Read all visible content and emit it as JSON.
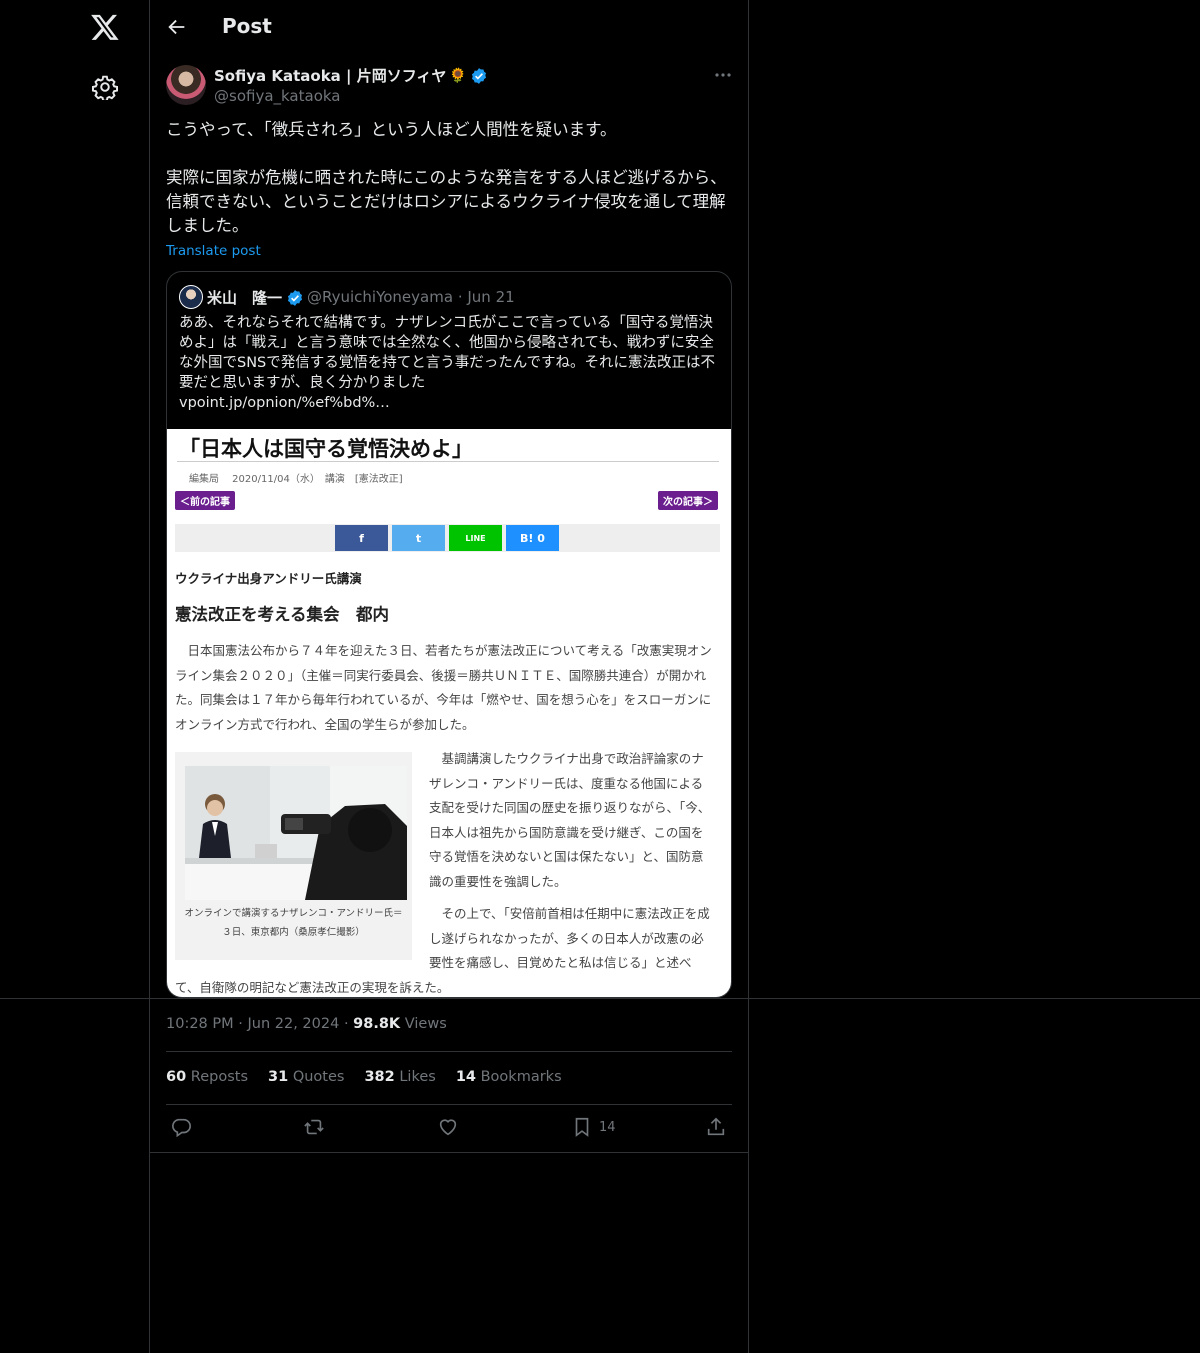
{
  "header": {
    "title": "Post"
  },
  "author": {
    "name": "Sofiya Kataoka | 片岡ソフィヤ",
    "emoji": "🌻",
    "handle": "@sofiya_kataoka"
  },
  "post": {
    "paragraphs": [
      "こうやって、「徴兵されろ」という人ほど人間性を疑います。",
      "実際に国家が危機に晒された時にこのような発言をする人ほど逃げるから、信頼できない、ということだけはロシアによるウクライナ侵攻を通して理解しました。"
    ],
    "translate_label": "Translate post"
  },
  "quote": {
    "name": "米山　隆一",
    "handle": "@RyuichiYoneyama",
    "date": "Jun 21",
    "text": "ああ、それならそれで結構です。ナザレンコ氏がここで言っている「国守る覚悟決めよ」は「戦え」と言う意味では全然なく、他国から侵略されても、戦わずに安全な外国でSNSで発信する覚悟を持てと言う事だったんですね。それに憲法改正は不要だと思いますが、良く分かりました",
    "link": "vpoint.jp/opnion/%ef%bd%…"
  },
  "article": {
    "title": "「日本人は国守る覚悟決めよ」",
    "meta": "編集局　 2020/11/04（水）　講演　[憲法改正]",
    "prev": "＜前の記事",
    "next": "次の記事＞",
    "share": [
      "f",
      "t",
      "LINE",
      "B! 0"
    ],
    "subtitle": "ウクライナ出身アンドリー氏講演",
    "headline": "憲法改正を考える集会　都内",
    "para1": "日本国憲法公布から７４年を迎えた３日、若者たちが憲法改正について考える「改憲実現オンライン集会２０２０」（主催＝同実行委員会、後援＝勝共ＵＮＩＴＥ、国際勝共連合）が開かれた。同集会は１７年から毎年行われているが、今年は「燃やせ、国を想う心を」をスローガンにオンライン方式で行われ、全国の学生らが参加した。",
    "caption": "オンラインで講演するナザレンコ・アンドリー氏＝３日、東京都内（桑原孝仁撮影）",
    "para2": "基調講演したウクライナ出身で政治評論家のナザレンコ・アンドリー氏は、度重なる他国による支配を受けた同国の歴史を振り返りながら、「今、日本人は祖先から国防意識を受け継ぎ、この国を守る覚悟を決めないと国は保たない」と、国防意識の重要性を強調した。",
    "para3": "その上で、「安倍前首相は任期中に憲法改正を成し遂げられなかったが、多くの日本人が改憲の必要性を痛感し、目覚めたと私は信じる」と述べ",
    "para4": "て、自衛隊の明記など憲法改正の実現を訴えた。"
  },
  "meta": {
    "time": "10:28 PM",
    "date": "Jun 22, 2024",
    "views": "98.8K",
    "views_label": "Views"
  },
  "stats": {
    "reposts": "60",
    "reposts_label": "Reposts",
    "quotes": "31",
    "quotes_label": "Quotes",
    "likes": "382",
    "likes_label": "Likes",
    "bookmarks": "14",
    "bookmarks_label": "Bookmarks"
  },
  "actions": {
    "bookmark_count": "14"
  },
  "colors": {
    "accent": "#1d9bf0",
    "muted": "#71767b",
    "border": "#2f3336",
    "background": "#000000"
  }
}
